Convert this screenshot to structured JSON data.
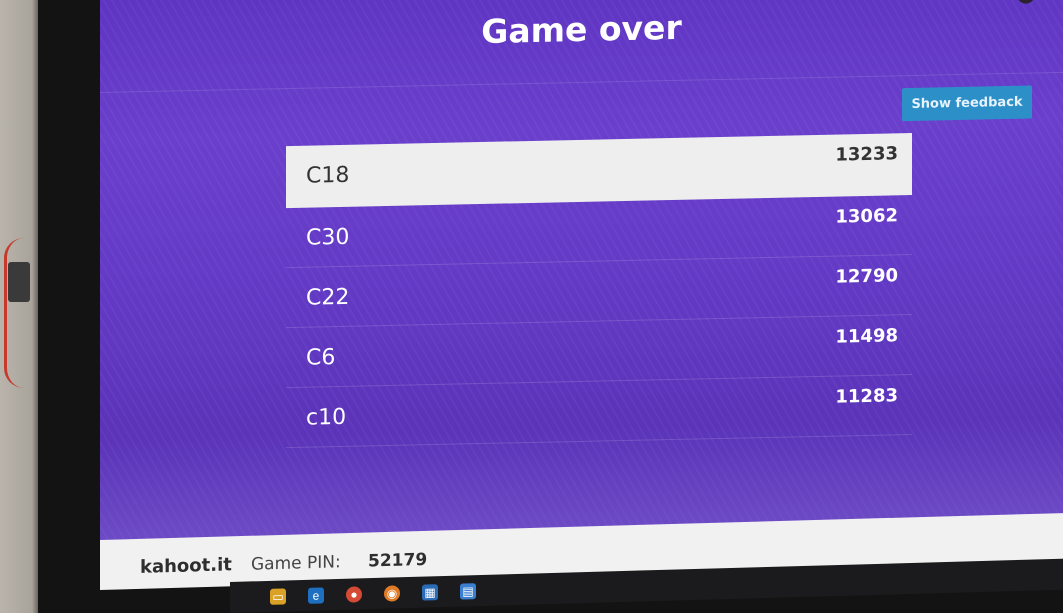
{
  "game": {
    "title": "Game over",
    "feedback_button": "Show feedback"
  },
  "scoreboard": [
    {
      "name": "C18",
      "score": "13233"
    },
    {
      "name": "C30",
      "score": "13062"
    },
    {
      "name": "C22",
      "score": "12790"
    },
    {
      "name": "C6",
      "score": "11498"
    },
    {
      "name": "c10",
      "score": "11283"
    }
  ],
  "footer": {
    "brand": "kahoot.it",
    "pin_label": "Game PIN:",
    "pin_value": "52179"
  },
  "icons": {
    "fullscreen": "fullscreen-icon",
    "taskbar": [
      "file-explorer-icon",
      "edge-icon",
      "chrome-icon",
      "firefox-icon",
      "store-icon",
      "document-icon"
    ]
  },
  "colors": {
    "background": "#6a3fcc",
    "feedback_button": "#2d8fc8",
    "first_place_row": "#eeeeee"
  }
}
